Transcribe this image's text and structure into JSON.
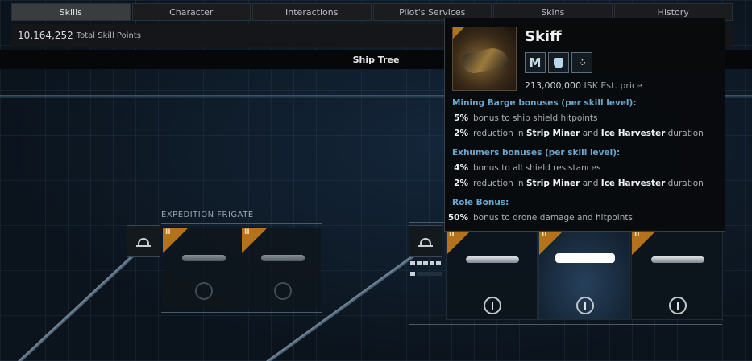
{
  "tabs": [
    {
      "label": "Skills",
      "active": true
    },
    {
      "label": "Character",
      "active": false
    },
    {
      "label": "Interactions",
      "active": false
    },
    {
      "label": "Pilot's Services",
      "active": false
    },
    {
      "label": "Skins",
      "active": false
    },
    {
      "label": "History",
      "active": false
    }
  ],
  "skill_points": {
    "value": "10,164,252",
    "label": "Total Skill Points"
  },
  "tree_header": "Ship Tree",
  "groups": {
    "expedition_frigate": {
      "label": "EXPEDITION FRIGATE",
      "tech": "II"
    },
    "exhumer": {
      "tech": "II"
    }
  },
  "tooltip": {
    "title": "Skiff",
    "price": "213,000,000",
    "price_unit": "ISK Est. price",
    "badges": [
      "M",
      "shield-icon",
      "drone-icon"
    ],
    "tech": "II",
    "sections": [
      {
        "heading": "Mining Barge bonuses (per skill level):",
        "rows": [
          {
            "pct": "5%",
            "parts": [
              {
                "t": "bonus to ship shield hitpoints",
                "b": false
              }
            ]
          },
          {
            "pct": "2%",
            "parts": [
              {
                "t": "reduction in ",
                "b": false
              },
              {
                "t": "Strip Miner",
                "b": true
              },
              {
                "t": " and ",
                "b": false
              },
              {
                "t": "Ice Harvester",
                "b": true
              },
              {
                "t": " duration",
                "b": false
              }
            ]
          }
        ]
      },
      {
        "heading": "Exhumers bonuses (per skill level):",
        "rows": [
          {
            "pct": "4%",
            "parts": [
              {
                "t": "bonus to all shield resistances",
                "b": false
              }
            ]
          },
          {
            "pct": "2%",
            "parts": [
              {
                "t": "reduction in ",
                "b": false
              },
              {
                "t": "Strip Miner",
                "b": true
              },
              {
                "t": " and ",
                "b": false
              },
              {
                "t": "Ice Harvester",
                "b": true
              },
              {
                "t": " duration",
                "b": false
              }
            ]
          }
        ]
      },
      {
        "heading": "Role Bonus:",
        "rows": [
          {
            "pct": "50%",
            "parts": [
              {
                "t": "bonus to drone damage and hitpoints",
                "b": false
              }
            ]
          }
        ]
      }
    ]
  },
  "skill_level": {
    "trained": 5,
    "max": 5
  },
  "colors": {
    "tech2": "#b4721c",
    "section_heading": "#6aa8d0"
  }
}
